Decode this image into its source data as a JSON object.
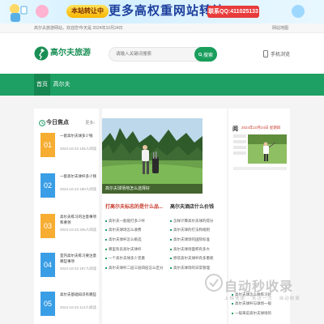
{
  "banner": {
    "tag": "本站转让中",
    "slogan": "更多高权重网站转让",
    "contact": "联系QQ:411025133"
  },
  "topbar": {
    "welcome": "高尔夫旅游网站，欢迎您！",
    "date": "今天是 2024年10月24日",
    "nav_link": "网站地图"
  },
  "header": {
    "logo_text": "高尔夫旅游",
    "search_placeholder": "请输入关键词搜索",
    "search_button": "搜索",
    "mobile_label": "手机浏览"
  },
  "nav": {
    "items": [
      {
        "label": "首页"
      },
      {
        "label": "高尔夫"
      }
    ]
  },
  "today": {
    "title": "今日焦点",
    "more": "更多",
    "items": [
      {
        "rank": "01",
        "title": "一套高尔夫球多少钱",
        "date": "2024-10-23",
        "views": "155人阅读"
      },
      {
        "rank": "02",
        "title": "一套高尔夫球杆多少钱",
        "date": "2024-10-23",
        "views": "190人阅读"
      },
      {
        "rank": "03",
        "title": "高尔夫练习的注意事项和要领",
        "date": "2024-10-23",
        "views": "205人阅读"
      },
      {
        "rank": "04",
        "title": "室内高尔夫练习要注意哪些事项",
        "date": "2024-10-23",
        "views": "197人阅读"
      },
      {
        "rank": "05",
        "title": "高尔夫基础知识有哪些",
        "date": "2024-10-23",
        "views": "113人阅读"
      }
    ]
  },
  "featured": {
    "caption": "高尔夫球场地怎么选择好"
  },
  "center": {
    "col1_title": "打高尔夫标志的是什么品...",
    "col2_title": "高尔夫酒店什么价钱",
    "col1_items": [
      "高尔夫一般能打多少杆",
      "高尔夫球场怎么收费",
      "高尔夫球杆怎么挑选",
      "哪里有卖高尔夫球杆",
      "一个高尔夫球多少克重",
      "高尔夫球杆二层三层四层怎么区分"
    ],
    "col2_items": [
      "怎样计算高尔夫球的得分",
      "高尔夫球的打法和规则",
      "高尔夫球场的国际标准",
      "高尔夫球场面积有多大",
      "原装高尔夫球杆有多重呢",
      "高尔夫球场的日常管理"
    ]
  },
  "right": {
    "head": "阅",
    "date": "2024年10月24日 星期四",
    "list": [
      "高尔夫球怎么样练习好",
      "高尔夫球杆与球场一般",
      "一般来说高尔夫球场的"
    ]
  },
  "watermark": {
    "title": "自动秒收录",
    "sub": "上榜快速 · 来访一次 · 自动收录"
  },
  "colors": {
    "brand_green": "#1e9f63",
    "rank_colors": [
      "#f6ad32",
      "#3a9ee6",
      "#f6ad32",
      "#3a9ee6",
      "#3a9ee6"
    ],
    "accent_red": "#c73c2e"
  }
}
